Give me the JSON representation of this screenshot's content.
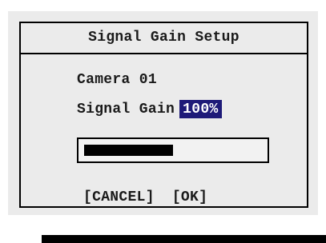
{
  "dialog": {
    "title": "Signal Gain Setup",
    "camera_label": "Camera 01",
    "gain_label": "Signal Gain",
    "gain_value": "100%",
    "gain_bar_fraction": 0.5,
    "cancel_label": "[CANCEL]",
    "ok_label": "[OK]"
  },
  "colors": {
    "dialog_bg": "#ebebeb",
    "highlight_bg": "#1e1a78",
    "highlight_text": "#ffffff",
    "border": "#000000"
  }
}
